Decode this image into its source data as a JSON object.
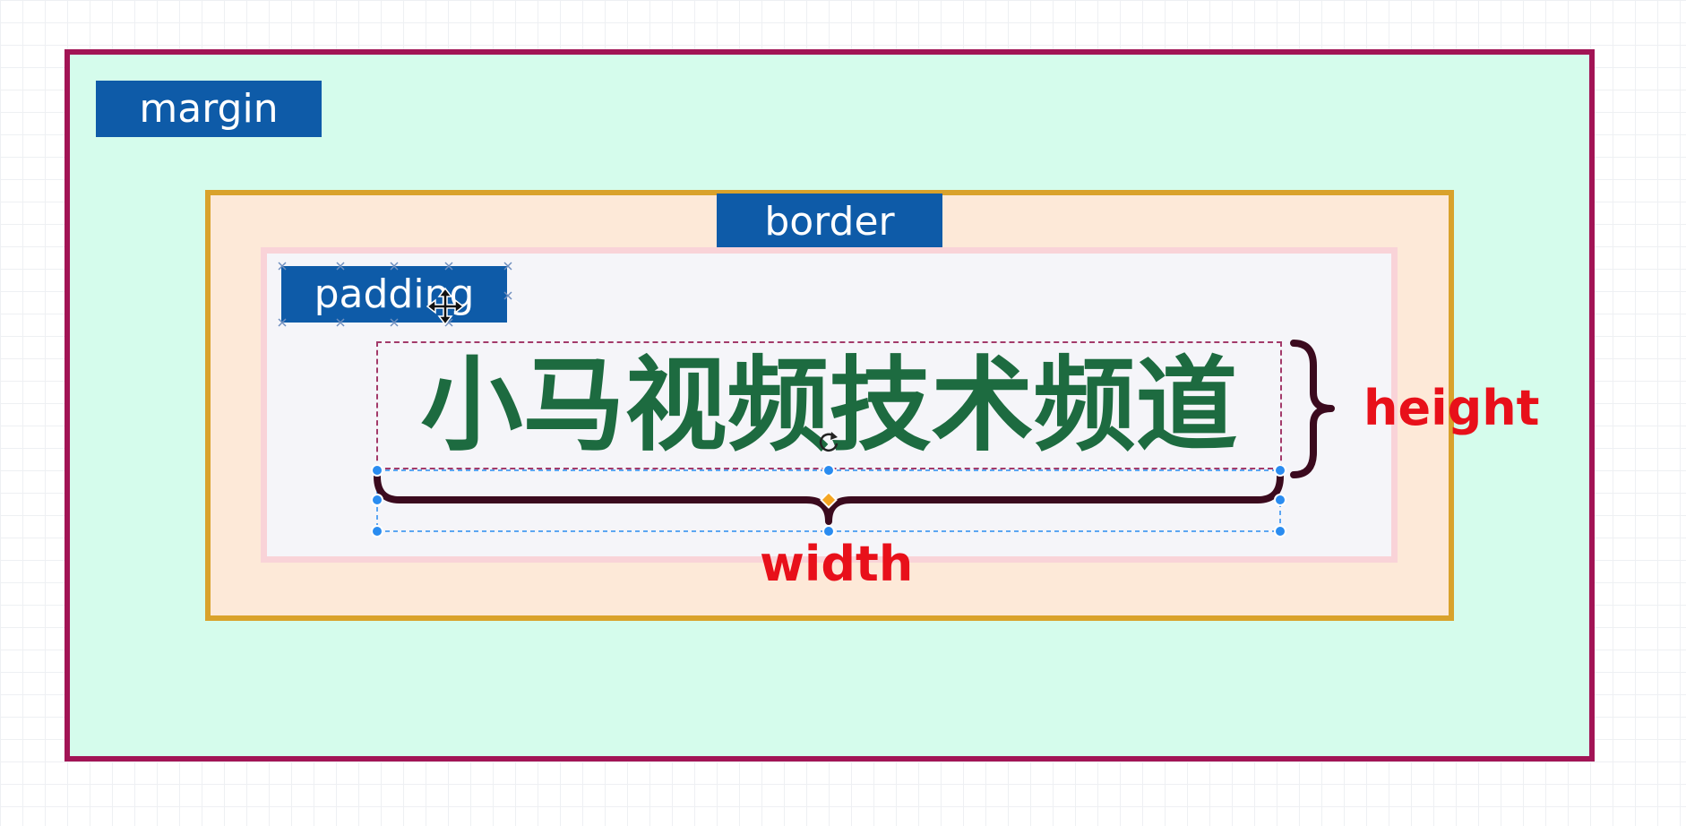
{
  "labels": {
    "margin": "margin",
    "border": "border",
    "padding": "padding"
  },
  "content": {
    "text": "小马视频技术频道"
  },
  "dimensions": {
    "height": "height",
    "width": "width"
  },
  "colors": {
    "margin_fill": "#d5fcec",
    "margin_stroke": "#a21455",
    "border_fill": "#fde9d8",
    "border_stroke": "#d9a22b",
    "padding_fill": "#f5f5f9",
    "padding_stroke": "#f9d3d8",
    "tag_fill": "#0e5ba8",
    "content_text": "#1d6b40",
    "brace": "#3b0a1e",
    "dimension_label": "#e8101a",
    "selection_handle": "#2a8cf0"
  },
  "icons": [
    "move-cursor-icon",
    "rotate-handle-icon"
  ]
}
